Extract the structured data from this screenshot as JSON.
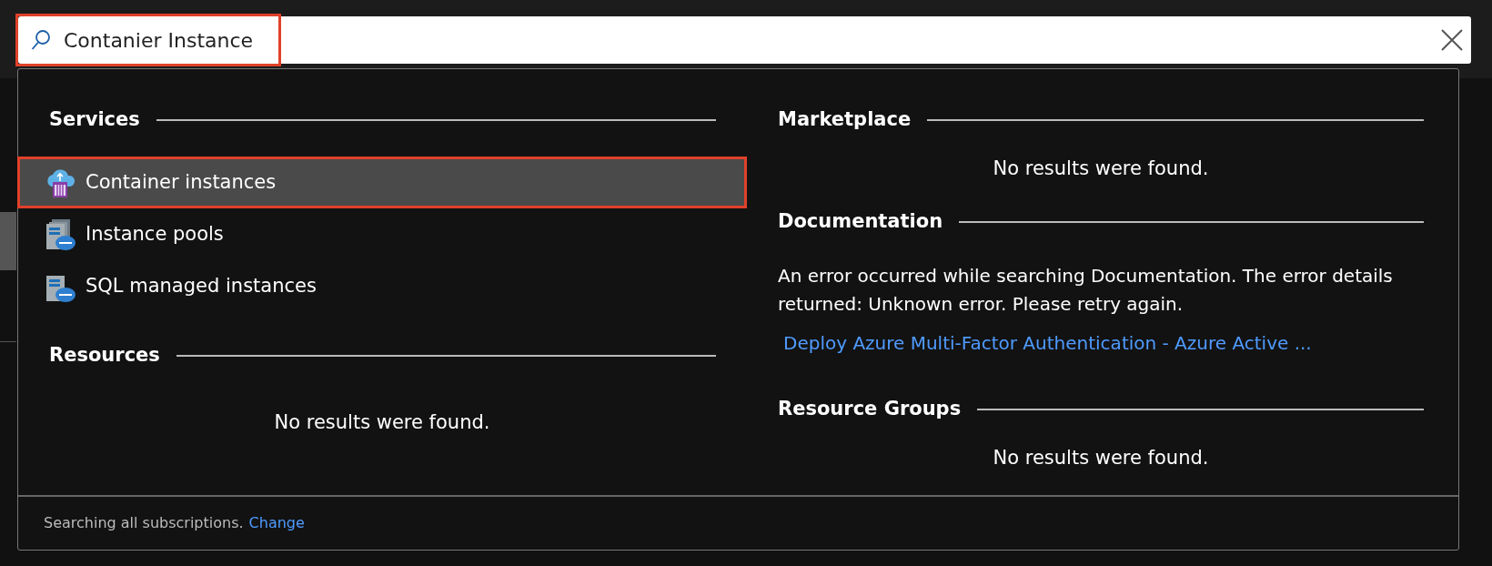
{
  "search": {
    "value": "Contanier Instance",
    "highlighted": true
  },
  "services": {
    "title": "Services",
    "items": [
      {
        "label": "Container instances",
        "kind": "container",
        "selected": true
      },
      {
        "label": "Instance pools",
        "kind": "sql-pool",
        "selected": false
      },
      {
        "label": "SQL managed instances",
        "kind": "sql-managed",
        "selected": false
      }
    ]
  },
  "resources": {
    "title": "Resources",
    "message": "No results were found."
  },
  "marketplace": {
    "title": "Marketplace",
    "message": "No results were found."
  },
  "documentation": {
    "title": "Documentation",
    "error": "An error occurred while searching Documentation. The error details returned: Unknown error. Please retry again.",
    "links": [
      "Deploy Azure Multi-Factor Authentication - Azure Active ..."
    ]
  },
  "resource_groups": {
    "title": "Resource Groups",
    "message": "No results were found."
  },
  "footer": {
    "text": "Searching all subscriptions.",
    "link": "Change"
  }
}
